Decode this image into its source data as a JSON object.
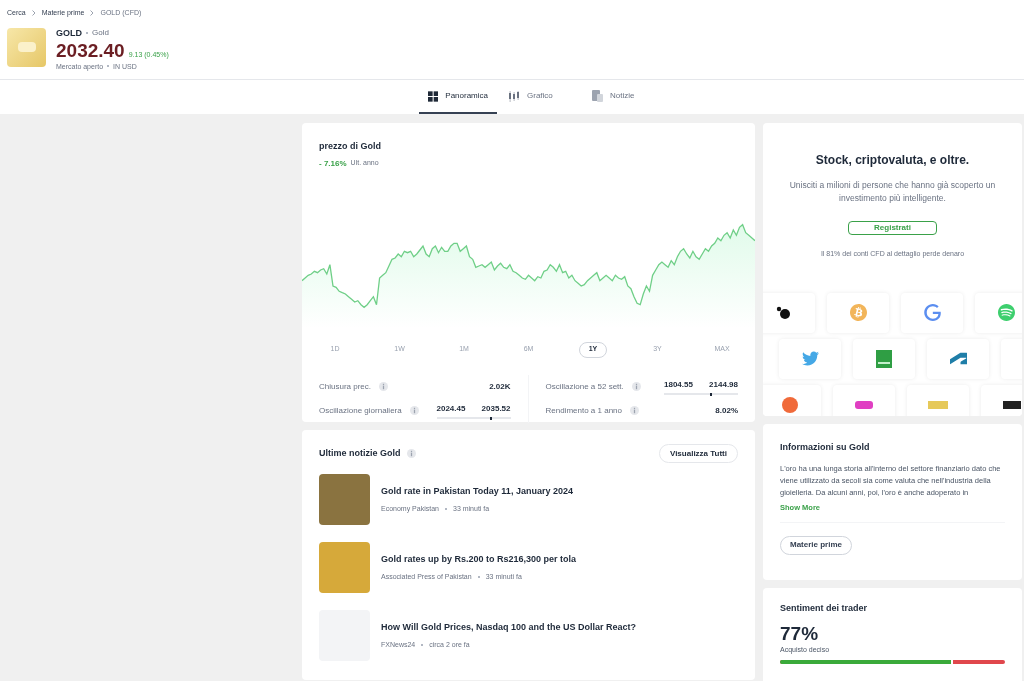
{
  "breadcrumbs": [
    "Cerca",
    "Materie prime",
    "GOLD (CFD)"
  ],
  "instrument": {
    "symbol": "GOLD",
    "name": "Gold",
    "price": "2032.40",
    "change": "9.13 (0.45%)",
    "status": "Mercato aperto",
    "currency": "IN USD"
  },
  "tabs": [
    {
      "label": "Panoramica",
      "selected": true
    },
    {
      "label": "Grafico",
      "selected": false
    },
    {
      "label": "Notizie",
      "selected": false
    }
  ],
  "price_card": {
    "title": "prezzo di Gold",
    "change": "- 7.16%",
    "period": "Ult. anno",
    "ranges": [
      {
        "label": "1D",
        "selected": false
      },
      {
        "label": "1W",
        "selected": false
      },
      {
        "label": "1M",
        "selected": false
      },
      {
        "label": "6M",
        "selected": false
      },
      {
        "label": "1Y",
        "selected": true
      },
      {
        "label": "3Y",
        "selected": false
      },
      {
        "label": "MAX",
        "selected": false
      }
    ],
    "stats": [
      {
        "kind": "value",
        "label": "Chiusura prec.",
        "value": "2.02K"
      },
      {
        "kind": "range",
        "label": "Oscillazione a 52 sett.",
        "low": "1804.55",
        "high": "2144.98",
        "level": 0.62
      },
      {
        "kind": "range",
        "label": "Oscillazione giornaliera",
        "low": "2024.45",
        "high": "2035.52",
        "level": 0.72
      },
      {
        "kind": "value",
        "label": "Rendimento a 1 anno",
        "value": "8.02%"
      }
    ]
  },
  "news": {
    "title": "Ultime notizie Gold",
    "view_all": "Visualizza Tutti",
    "items": [
      {
        "title": "Gold rate in Pakistan Today 11, January 2024",
        "source": "Economy Pakistan",
        "time": "33 minuti fa"
      },
      {
        "title": "Gold rates up by Rs.200 to Rs216,300 per tola",
        "source": "Associated Press of Pakistan",
        "time": "33 minuti fa"
      },
      {
        "title": "How Will Gold Prices, Nasdaq 100 and the US Dollar React?",
        "source": "FXNews24",
        "time": "circa 2 ore fa"
      }
    ]
  },
  "promo": {
    "title": "Stock, criptovaluta, e oltre.",
    "text": "Unisciti a milioni di persone che hanno già scoperto un investimento più intelligente.",
    "button": "Registrati",
    "disclaimer": "Il 81% dei conti CFD al dettaglio perde denaro"
  },
  "about": {
    "title": "Informazioni su Gold",
    "text": "L'oro ha una lunga storia all'interno del settore finanziario dato che viene utilizzato da secoli sia come valuta che nell'industria della gioielleria. Da alcuni anni, poi, l'oro è anche adoperato in",
    "show_more": "Show More",
    "tag": "Materie prime"
  },
  "sentiment": {
    "title": "Sentiment dei trader",
    "percent": "77%",
    "label": "Acquisto deciso",
    "level": 0.77
  }
}
